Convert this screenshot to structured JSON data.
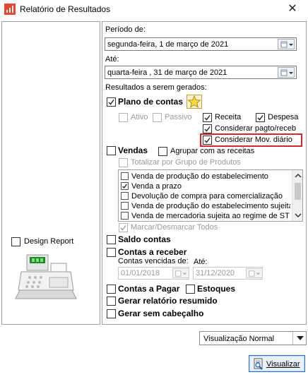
{
  "window": {
    "title": "Relatório de Resultados",
    "close_glyph": "✕",
    "icon": "report-app-icon"
  },
  "left": {
    "design_report_label": "Design Report",
    "design_report_checked": false,
    "illustration": "cash-register-image"
  },
  "periodo": {
    "label_from": "Período de:",
    "from_value": "segunda-feira,  1 de   março   de 2021",
    "label_to": "Até:",
    "to_value": "quarta-feira , 31 de   março   de 2021"
  },
  "resultados_label": "Resultados a serem gerados:",
  "plano": {
    "label": "Plano de contas",
    "checked": true,
    "ativo": "Ativo",
    "passivo": "Passivo",
    "receita": "Receita",
    "despesa": "Despesa",
    "pagto_receb": "Considerar pagto/receb",
    "mov_diario": "Considerar Mov. diário"
  },
  "vendas": {
    "label": "Vendas",
    "checked": false,
    "agrupar": "Agrupar com as receitas",
    "totalizar": "Totalizar por Grupo de Produtos",
    "items": [
      {
        "label": "Venda de produção do estabelecimento",
        "checked": false
      },
      {
        "label": "Venda a prazo",
        "checked": true
      },
      {
        "label": "Devolução de compra para comercialização",
        "checked": false
      },
      {
        "label": "Venda de produção do estabelecimento sujeita",
        "checked": false
      },
      {
        "label": "Venda de mercadoria sujeita ao regime de ST",
        "checked": false
      }
    ],
    "marcar": "Marcar/Desmarcar Todos"
  },
  "saldo_label": "Saldo contas",
  "receber": {
    "label": "Contas a receber",
    "vencidas_label": "Contas vencidas de:",
    "ate_label": "Até:",
    "from_date": "01/01/2018",
    "to_date": "31/12/2020"
  },
  "pagar_label": "Contas a Pagar",
  "estoques_label": "Estoques",
  "resumido_label": "Gerar relatório resumido",
  "cabecalho_label": "Gerar sem cabeçalho",
  "view_select": {
    "value": "Visualização Normal"
  },
  "visualizar_button": {
    "label": "Visualizar"
  },
  "colors": {
    "highlight": "#d7262e",
    "app_icon": "#e8472f",
    "button_border": "#2b70d6"
  }
}
